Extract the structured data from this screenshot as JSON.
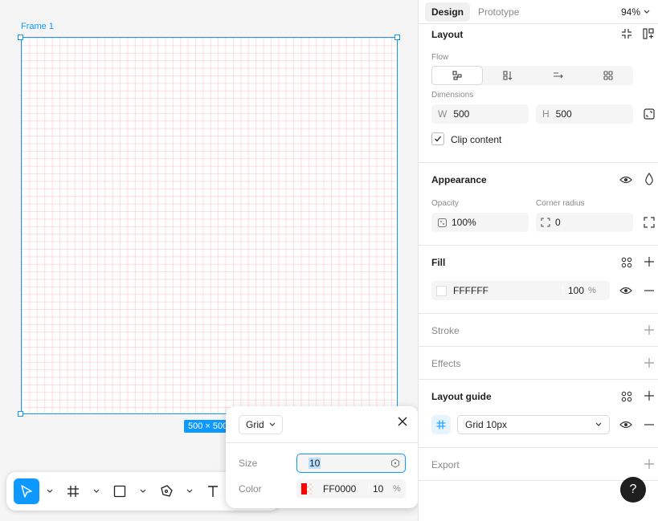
{
  "canvas": {
    "frame_label": "Frame 1",
    "size_badge": "500 × 500"
  },
  "toolbar": {
    "tools": [
      "move-tool",
      "frame-tool",
      "rectangle-tool",
      "pen-tool",
      "text-tool"
    ]
  },
  "grid_popup": {
    "type_label": "Grid",
    "size_label": "Size",
    "size_value": "10",
    "color_label": "Color",
    "color_hex": "FF0000",
    "color_opacity": "10",
    "percent": "%"
  },
  "panel": {
    "tabs": [
      "Design",
      "Prototype"
    ],
    "zoom": "94%",
    "layout": {
      "title": "Layout",
      "flow_label": "Flow",
      "dimensions_label": "Dimensions",
      "width_prefix": "W",
      "width": "500",
      "height_prefix": "H",
      "height": "500",
      "clip_content": "Clip content",
      "clip_checked": true
    },
    "appearance": {
      "title": "Appearance",
      "opacity_label": "Opacity",
      "opacity": "100%",
      "radius_label": "Corner radius",
      "radius": "0"
    },
    "fill": {
      "title": "Fill",
      "hex": "FFFFFF",
      "opacity": "100",
      "percent": "%"
    },
    "stroke": {
      "title": "Stroke"
    },
    "effects": {
      "title": "Effects"
    },
    "layout_guide": {
      "title": "Layout guide",
      "grid_value": "Grid 10px"
    },
    "export": {
      "title": "Export"
    }
  },
  "help_label": "?",
  "colors": {
    "accent": "#0d99ff",
    "grid_line": "#ff0000"
  }
}
